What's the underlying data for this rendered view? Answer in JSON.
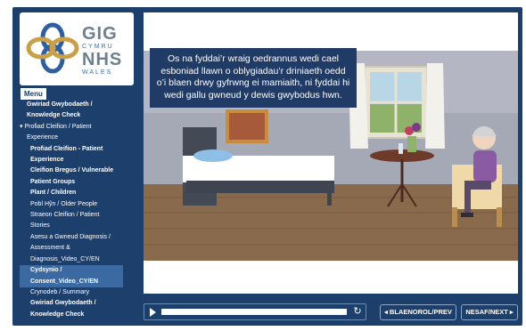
{
  "logo": {
    "line1": "GIG",
    "line2": "CYMRU",
    "line3": "NHS",
    "line4": "WALES"
  },
  "menu": {
    "label": "Menu",
    "items": [
      {
        "label": "Gwiriad Gwybodaeth /",
        "style": "bold sub"
      },
      {
        "label": "Knowledge Check",
        "style": "bold sub"
      },
      {
        "label": "▾ Profiad Cleifion / Patient",
        "style": "section"
      },
      {
        "label": "Experience",
        "style": "sub"
      },
      {
        "label": "Profiad Cleifion - Patient",
        "style": "bold"
      },
      {
        "label": "Experience",
        "style": "bold"
      },
      {
        "label": "Cleifion Bregus / Vulnerable",
        "style": "bold"
      },
      {
        "label": "Patient Groups",
        "style": "bold"
      },
      {
        "label": "Plant / Children",
        "style": "bold"
      },
      {
        "label": "Pobl Hŷn / Older People",
        "style": ""
      },
      {
        "label": "Straeon Cleifion / Patient",
        "style": ""
      },
      {
        "label": "Stories",
        "style": ""
      },
      {
        "label": "Asesu a Gwneud Diagnosis /",
        "style": ""
      },
      {
        "label": "Assessment &",
        "style": ""
      },
      {
        "label": "Diagnosis_Video_CY/EN",
        "style": ""
      },
      {
        "label": "Cydsynio /",
        "style": "bold hl"
      },
      {
        "label": "Consent_Video_CY/EN",
        "style": "bold hl"
      },
      {
        "label": "Crynodeb / Summary",
        "style": ""
      },
      {
        "label": "Gwiriad Gwybodaeth /",
        "style": "bold"
      },
      {
        "label": "Knowledge Check",
        "style": "bold"
      }
    ]
  },
  "caption": "Os na fyddai’r wraig oedrannus wedi cael esboniad llawn o oblygiadau’r driniaeth oedd o’i blaen drwy gyfrwng ei mamiaith, ni fyddai hi wedi gallu gwneud y dewis gwybodus hwn.",
  "player": {
    "progress": 0.88,
    "prev_label": "◂ BLAENOROL/PREV",
    "next_label": "NESAF/NEXT ▸"
  },
  "colors": {
    "frame": "#1d3f6c",
    "caption_bg": "#203c66",
    "highlight": "#3b6aa3"
  }
}
